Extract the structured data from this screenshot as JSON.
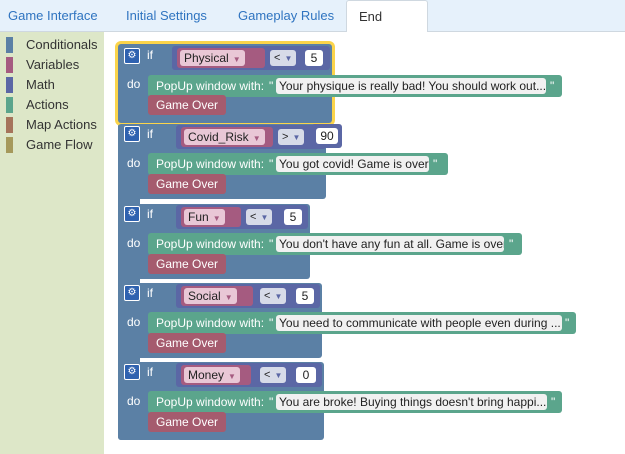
{
  "tabs": [
    {
      "label": "Game Interface"
    },
    {
      "label": "Initial Settings"
    },
    {
      "label": "Gameplay Rules"
    },
    {
      "label": "End Rules"
    }
  ],
  "toolbox": {
    "categories": [
      {
        "label": "Conditionals",
        "color": "#5b80a5"
      },
      {
        "label": "Variables",
        "color": "#a55b80"
      },
      {
        "label": "Math",
        "color": "#5b67a5"
      },
      {
        "label": "Actions",
        "color": "#5ba58c"
      },
      {
        "label": "Map Actions",
        "color": "#a5745b"
      },
      {
        "label": "Game Flow",
        "color": "#a5995b"
      }
    ]
  },
  "blocks": {
    "if_label": "if",
    "do_label": "do",
    "popup_label": "PopUp window with:",
    "quote": "\"",
    "game_over_label": "Game Over",
    "rules": [
      {
        "variable": "Physical",
        "operator": "<",
        "value": "5",
        "message": "Your physique is really bad! You should work out..."
      },
      {
        "variable": "Covid_Risk",
        "operator": ">",
        "value": "90",
        "message": "You got covid! Game is over"
      },
      {
        "variable": "Fun",
        "operator": "<",
        "value": "5",
        "message": "You don't have any fun at all. Game is over"
      },
      {
        "variable": "Social",
        "operator": "<",
        "value": "5",
        "message": "You need to communicate with people even during ..."
      },
      {
        "variable": "Money",
        "operator": "<",
        "value": "0",
        "message": "You are broke! Buying things doesn't bring happi..."
      }
    ]
  }
}
